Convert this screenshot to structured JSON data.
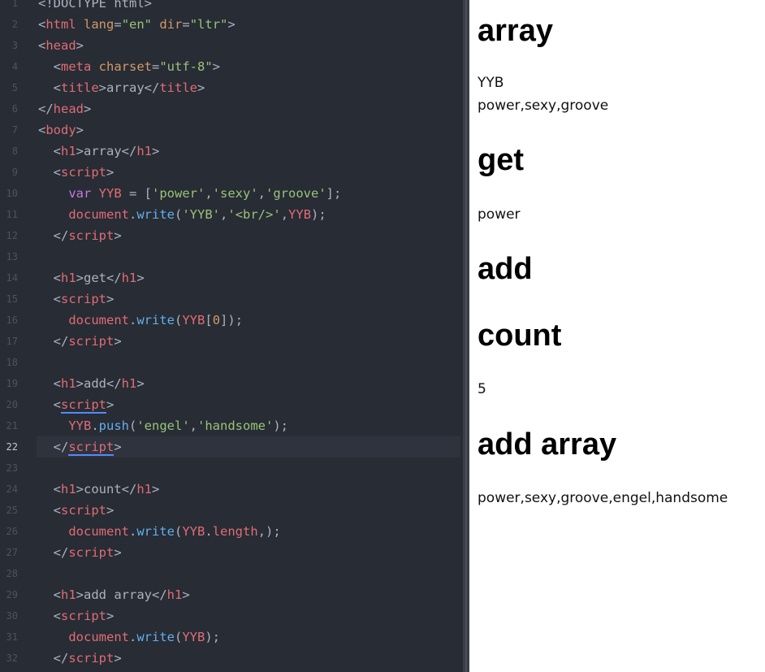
{
  "editor": {
    "active_line": 22,
    "lines": [
      [
        {
          "t": "plain",
          "v": "<!DOCTYPE html>"
        }
      ],
      [
        {
          "t": "plain",
          "v": "<"
        },
        {
          "t": "tag",
          "v": "html"
        },
        {
          "t": "plain",
          "v": " "
        },
        {
          "t": "attr",
          "v": "lang"
        },
        {
          "t": "plain",
          "v": "="
        },
        {
          "t": "str",
          "v": "\"en\""
        },
        {
          "t": "plain",
          "v": " "
        },
        {
          "t": "attr",
          "v": "dir"
        },
        {
          "t": "plain",
          "v": "="
        },
        {
          "t": "str",
          "v": "\"ltr\""
        },
        {
          "t": "plain",
          "v": ">"
        }
      ],
      [
        {
          "t": "plain",
          "v": "<"
        },
        {
          "t": "tag",
          "v": "head"
        },
        {
          "t": "plain",
          "v": ">"
        }
      ],
      [
        {
          "t": "plain",
          "v": "  <"
        },
        {
          "t": "tag",
          "v": "meta"
        },
        {
          "t": "plain",
          "v": " "
        },
        {
          "t": "attr",
          "v": "charset"
        },
        {
          "t": "plain",
          "v": "="
        },
        {
          "t": "str",
          "v": "\"utf-8\""
        },
        {
          "t": "plain",
          "v": ">"
        }
      ],
      [
        {
          "t": "plain",
          "v": "  <"
        },
        {
          "t": "tag",
          "v": "title"
        },
        {
          "t": "plain",
          "v": ">array</"
        },
        {
          "t": "tag",
          "v": "title"
        },
        {
          "t": "plain",
          "v": ">"
        }
      ],
      [
        {
          "t": "plain",
          "v": "</"
        },
        {
          "t": "tag",
          "v": "head"
        },
        {
          "t": "plain",
          "v": ">"
        }
      ],
      [
        {
          "t": "plain",
          "v": "<"
        },
        {
          "t": "tag",
          "v": "body"
        },
        {
          "t": "plain",
          "v": ">"
        }
      ],
      [
        {
          "t": "plain",
          "v": "  <"
        },
        {
          "t": "tag",
          "v": "h1"
        },
        {
          "t": "plain",
          "v": ">array</"
        },
        {
          "t": "tag",
          "v": "h1"
        },
        {
          "t": "plain",
          "v": ">"
        }
      ],
      [
        {
          "t": "plain",
          "v": "  <"
        },
        {
          "t": "tag",
          "v": "script"
        },
        {
          "t": "plain",
          "v": ">"
        }
      ],
      [
        {
          "t": "plain",
          "v": "    "
        },
        {
          "t": "kw",
          "v": "var"
        },
        {
          "t": "plain",
          "v": " "
        },
        {
          "t": "var",
          "v": "YYB"
        },
        {
          "t": "plain",
          "v": " = ["
        },
        {
          "t": "str",
          "v": "'power'"
        },
        {
          "t": "plain",
          "v": ","
        },
        {
          "t": "str",
          "v": "'sexy'"
        },
        {
          "t": "plain",
          "v": ","
        },
        {
          "t": "str",
          "v": "'groove'"
        },
        {
          "t": "plain",
          "v": "];"
        }
      ],
      [
        {
          "t": "plain",
          "v": "    "
        },
        {
          "t": "var",
          "v": "document"
        },
        {
          "t": "plain",
          "v": "."
        },
        {
          "t": "fn",
          "v": "write"
        },
        {
          "t": "plain",
          "v": "("
        },
        {
          "t": "str",
          "v": "'YYB'"
        },
        {
          "t": "plain",
          "v": ","
        },
        {
          "t": "str",
          "v": "'<br/>'"
        },
        {
          "t": "plain",
          "v": ","
        },
        {
          "t": "var",
          "v": "YYB"
        },
        {
          "t": "plain",
          "v": ");"
        }
      ],
      [
        {
          "t": "plain",
          "v": "  </"
        },
        {
          "t": "tag",
          "v": "script"
        },
        {
          "t": "plain",
          "v": ">"
        }
      ],
      [],
      [
        {
          "t": "plain",
          "v": "  <"
        },
        {
          "t": "tag",
          "v": "h1"
        },
        {
          "t": "plain",
          "v": ">get</"
        },
        {
          "t": "tag",
          "v": "h1"
        },
        {
          "t": "plain",
          "v": ">"
        }
      ],
      [
        {
          "t": "plain",
          "v": "  <"
        },
        {
          "t": "tag",
          "v": "script"
        },
        {
          "t": "plain",
          "v": ">"
        }
      ],
      [
        {
          "t": "plain",
          "v": "    "
        },
        {
          "t": "var",
          "v": "document"
        },
        {
          "t": "plain",
          "v": "."
        },
        {
          "t": "fn",
          "v": "write"
        },
        {
          "t": "plain",
          "v": "("
        },
        {
          "t": "var",
          "v": "YYB"
        },
        {
          "t": "plain",
          "v": "["
        },
        {
          "t": "num",
          "v": "0"
        },
        {
          "t": "plain",
          "v": "]);"
        }
      ],
      [
        {
          "t": "plain",
          "v": "  </"
        },
        {
          "t": "tag",
          "v": "script"
        },
        {
          "t": "plain",
          "v": ">"
        }
      ],
      [],
      [
        {
          "t": "plain",
          "v": "  <"
        },
        {
          "t": "tag",
          "v": "h1"
        },
        {
          "t": "plain",
          "v": ">add</"
        },
        {
          "t": "tag",
          "v": "h1"
        },
        {
          "t": "plain",
          "v": ">"
        }
      ],
      [
        {
          "t": "plain",
          "v": "  <"
        },
        {
          "t": "tag",
          "v": "script",
          "ul": true
        },
        {
          "t": "plain",
          "v": ">"
        }
      ],
      [
        {
          "t": "plain",
          "v": "    "
        },
        {
          "t": "var",
          "v": "YYB"
        },
        {
          "t": "plain",
          "v": "."
        },
        {
          "t": "fn",
          "v": "push"
        },
        {
          "t": "plain",
          "v": "("
        },
        {
          "t": "str",
          "v": "'engel'"
        },
        {
          "t": "plain",
          "v": ","
        },
        {
          "t": "str",
          "v": "'handsome'"
        },
        {
          "t": "plain",
          "v": ");"
        }
      ],
      [
        {
          "t": "plain",
          "v": "  </"
        },
        {
          "t": "tag",
          "v": "script",
          "ul": true
        },
        {
          "t": "plain",
          "v": ">"
        }
      ],
      [],
      [
        {
          "t": "plain",
          "v": "  <"
        },
        {
          "t": "tag",
          "v": "h1"
        },
        {
          "t": "plain",
          "v": ">count</"
        },
        {
          "t": "tag",
          "v": "h1"
        },
        {
          "t": "plain",
          "v": ">"
        }
      ],
      [
        {
          "t": "plain",
          "v": "  <"
        },
        {
          "t": "tag",
          "v": "script"
        },
        {
          "t": "plain",
          "v": ">"
        }
      ],
      [
        {
          "t": "plain",
          "v": "    "
        },
        {
          "t": "var",
          "v": "document"
        },
        {
          "t": "plain",
          "v": "."
        },
        {
          "t": "fn",
          "v": "write"
        },
        {
          "t": "plain",
          "v": "("
        },
        {
          "t": "var",
          "v": "YYB"
        },
        {
          "t": "plain",
          "v": "."
        },
        {
          "t": "var",
          "v": "length"
        },
        {
          "t": "plain",
          "v": ",);"
        }
      ],
      [
        {
          "t": "plain",
          "v": "  </"
        },
        {
          "t": "tag",
          "v": "script"
        },
        {
          "t": "plain",
          "v": ">"
        }
      ],
      [],
      [
        {
          "t": "plain",
          "v": "  <"
        },
        {
          "t": "tag",
          "v": "h1"
        },
        {
          "t": "plain",
          "v": ">add array</"
        },
        {
          "t": "tag",
          "v": "h1"
        },
        {
          "t": "plain",
          "v": ">"
        }
      ],
      [
        {
          "t": "plain",
          "v": "  <"
        },
        {
          "t": "tag",
          "v": "script"
        },
        {
          "t": "plain",
          "v": ">"
        }
      ],
      [
        {
          "t": "plain",
          "v": "    "
        },
        {
          "t": "var",
          "v": "document"
        },
        {
          "t": "plain",
          "v": "."
        },
        {
          "t": "fn",
          "v": "write"
        },
        {
          "t": "plain",
          "v": "("
        },
        {
          "t": "var",
          "v": "YYB"
        },
        {
          "t": "plain",
          "v": ");"
        }
      ],
      [
        {
          "t": "plain",
          "v": "  </"
        },
        {
          "t": "tag",
          "v": "script"
        },
        {
          "t": "plain",
          "v": ">"
        }
      ]
    ],
    "colors": {
      "background": "#282c34",
      "tag": "#e06c75",
      "attribute": "#d19a66",
      "string": "#98c379",
      "keyword": "#c678dd",
      "function": "#61afef",
      "plain": "#abb2bf"
    }
  },
  "preview": {
    "sections": [
      {
        "heading": "array",
        "output": [
          "YYB",
          "power,sexy,groove"
        ]
      },
      {
        "heading": "get",
        "output": [
          "power"
        ]
      },
      {
        "heading": "add",
        "output": []
      },
      {
        "heading": "count",
        "output": [
          "5"
        ]
      },
      {
        "heading": "add array",
        "output": [
          "power,sexy,groove,engel,handsome"
        ]
      }
    ]
  }
}
